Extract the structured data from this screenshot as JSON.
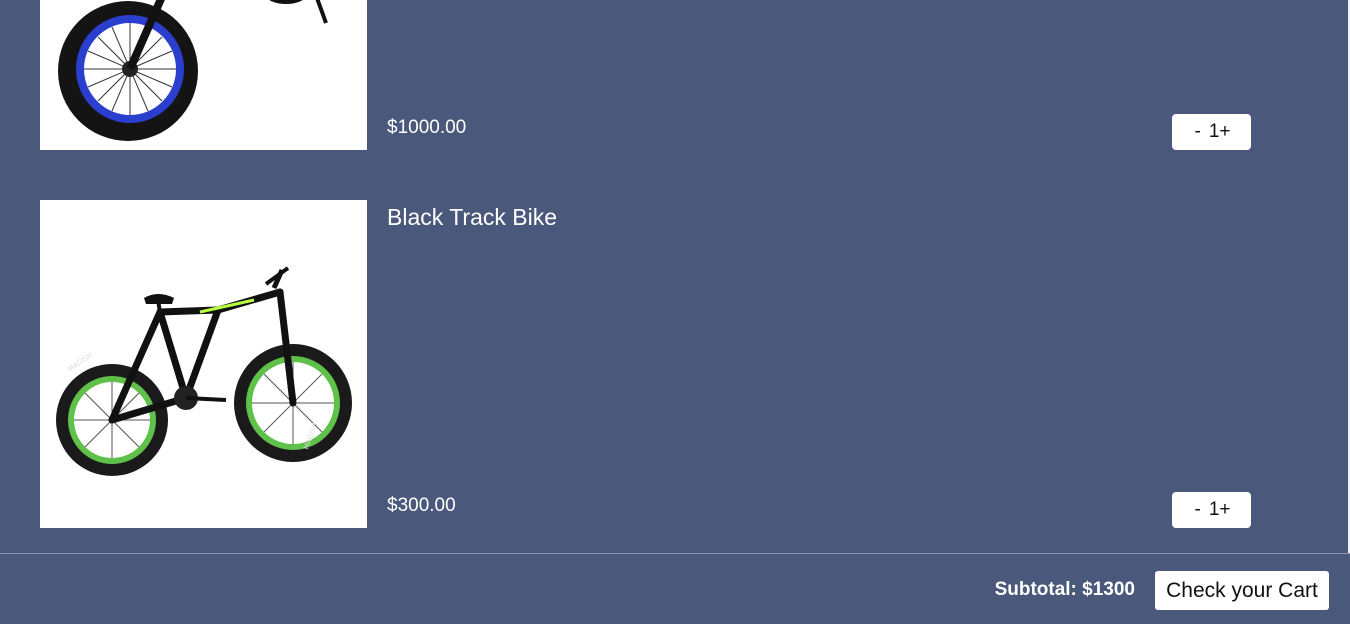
{
  "cart": {
    "items": [
      {
        "name": "",
        "price": "$1000.00",
        "qty_minus": "-",
        "qty_value": "1",
        "qty_plus": "+",
        "image_icon": "blue-fat-tire-bike-image"
      },
      {
        "name": "Black Track Bike",
        "price": "$300.00",
        "qty_minus": "-",
        "qty_value": "1",
        "qty_plus": "+",
        "image_icon": "green-fat-tire-bike-image"
      }
    ]
  },
  "footer": {
    "subtotal": "Subtotal: $1300",
    "checkout_label": "Check your Cart"
  },
  "colors": {
    "background": "#4a587b",
    "rim_blue": "#2b3fcf",
    "rim_green": "#5fc04a",
    "frame_accent": "#b8ff3c"
  }
}
